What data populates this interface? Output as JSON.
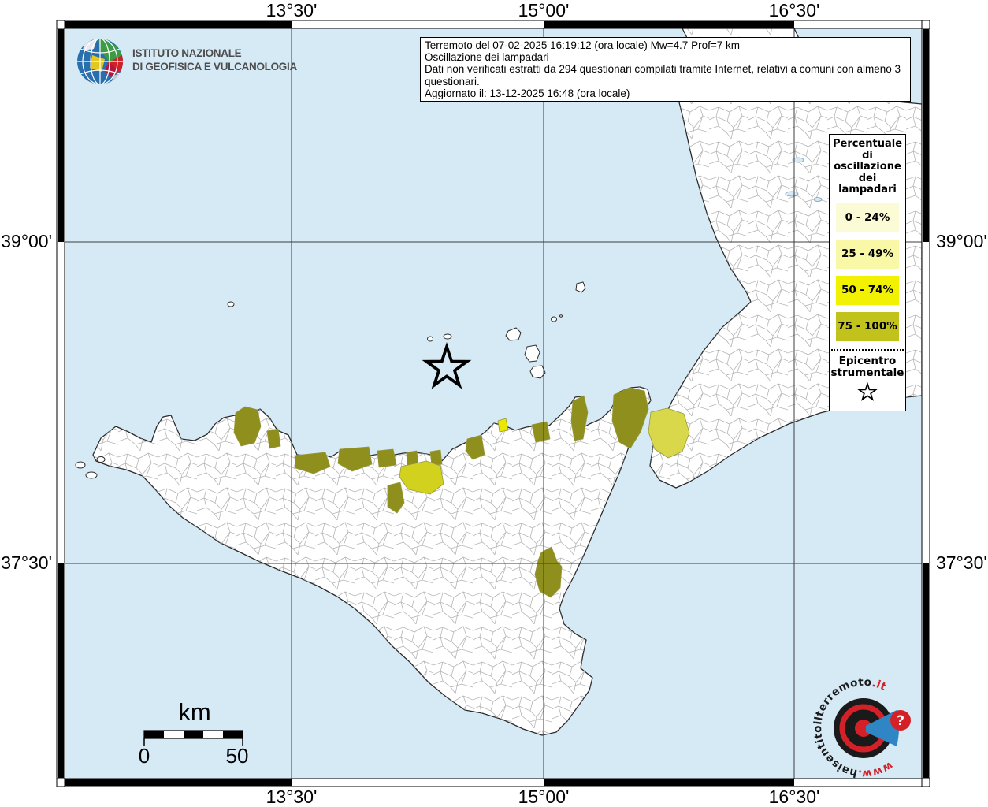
{
  "title_box": {
    "lines": [
      "Terremoto del 07-02-2025 16:19:12 (ora locale) Mw=4.7 Prof=7 km",
      "Oscillazione dei lampadari",
      "Dati non verificati estratti da 294 questionari compilati tramite Internet, relativi a comuni con almeno 3 questionari.",
      "Aggiornato il: 13-12-2025 16:48 (ora locale)"
    ]
  },
  "ingv": {
    "line1": "ISTITUTO NAZIONALE",
    "line2": "DI GEOFISICA E VULCANOLOGIA"
  },
  "axis": {
    "meridians": [
      "13°30'",
      "15°00'",
      "16°30'"
    ],
    "parallels": [
      "39°00'",
      "37°30'"
    ]
  },
  "legend": {
    "title_lines": [
      "Percentuale",
      "di",
      "oscillazione",
      "dei",
      "lampadari"
    ],
    "items": [
      {
        "label": "0 - 24%"
      },
      {
        "label": "25 - 49%"
      },
      {
        "label": "50 - 74%"
      },
      {
        "label": "75 - 100%"
      }
    ],
    "epicenter_line1": "Epicentro",
    "epicenter_line2": "strumentale",
    "epicenter_symbol": "star-outline"
  },
  "scalebar": {
    "unit": "km",
    "start": "0",
    "end": "50"
  },
  "watermark": {
    "pre": "www.",
    "mid": "haisentitoilterremoto",
    "suf": ".it",
    "question": "?"
  },
  "colors": {
    "sea": "#d6eaf6",
    "land": "#ffffff",
    "coast": "#2b2b2b",
    "boundary": "#b5b5b5",
    "grid": "#3c3c3c",
    "cat1": "#fbfbd5",
    "cat2": "#f8f8a6",
    "cat3": "#f2f200",
    "cat4": "#c2c21c",
    "shade_high": "#8f8f1e",
    "shade_mid": "#d2d21e",
    "shade_bright": "#e8e800",
    "shade_toe": "#d8d84a",
    "red": "#d42027",
    "blue": "#2f86c4",
    "ingv_text": "#4d4d4d"
  }
}
